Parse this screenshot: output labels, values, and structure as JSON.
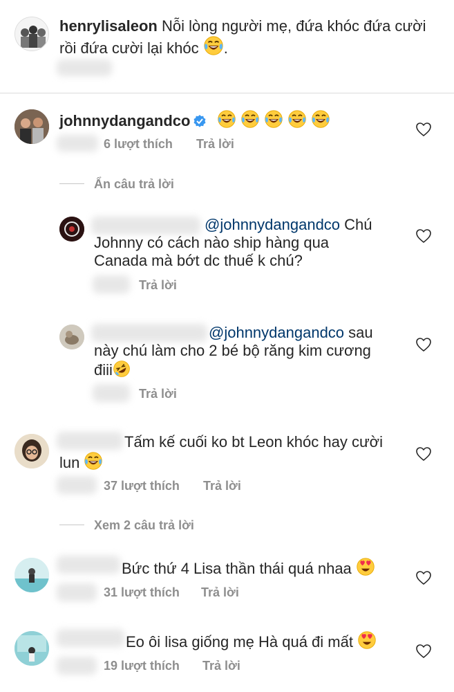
{
  "post_caption": {
    "username": "henrylisaleon",
    "text_line1": "Nỗi lòng người mẹ, đứa khóc đứa cười",
    "text_line2": "rồi đứa cười lại khóc",
    "text_end": "."
  },
  "comments": [
    {
      "username": "johnnydangandco",
      "verified": true,
      "emoji_count": 5,
      "likes": "6 lượt thích",
      "reply": "Trả lời",
      "toggle_replies": "Ẩn câu trả lời",
      "replies": [
        {
          "mention": "@johnnydangandco",
          "line1_rest": "Chú",
          "line2": "Johnny có cách nào ship hàng qua",
          "line3": "Canada mà bớt dc thuế k chú?",
          "reply": "Trả lời"
        },
        {
          "mention": "@johnnydangandco",
          "line1_rest": "sau",
          "line2": "này chú làm cho 2 bé bộ răng kim cương",
          "line3": "điii",
          "reply": "Trả lời"
        }
      ]
    },
    {
      "line1": "Tấm kế cuối ko bt Leon khóc hay cười",
      "line2": "lun",
      "likes": "37 lượt thích",
      "reply": "Trả lời",
      "view_replies": "Xem 2 câu trả lời"
    },
    {
      "text": "Bức thứ 4 Lisa thần thái quá nhaa",
      "likes": "31 lượt thích",
      "reply": "Trả lời"
    },
    {
      "text": "Eo ôi lisa giống mẹ Hà quá đi mất",
      "likes": "19 lượt thích",
      "reply": "Trả lời"
    }
  ],
  "icons": {
    "like": "heart-outline-icon",
    "laugh": "tears-of-joy-emoji",
    "rofl": "rolling-laughing-emoji",
    "love": "heart-eyes-emoji",
    "verified": "verified-badge-icon"
  },
  "colors": {
    "text": "#262626",
    "meta": "#8e8e8e",
    "mention": "#00376b",
    "verified": "#3897f0"
  }
}
